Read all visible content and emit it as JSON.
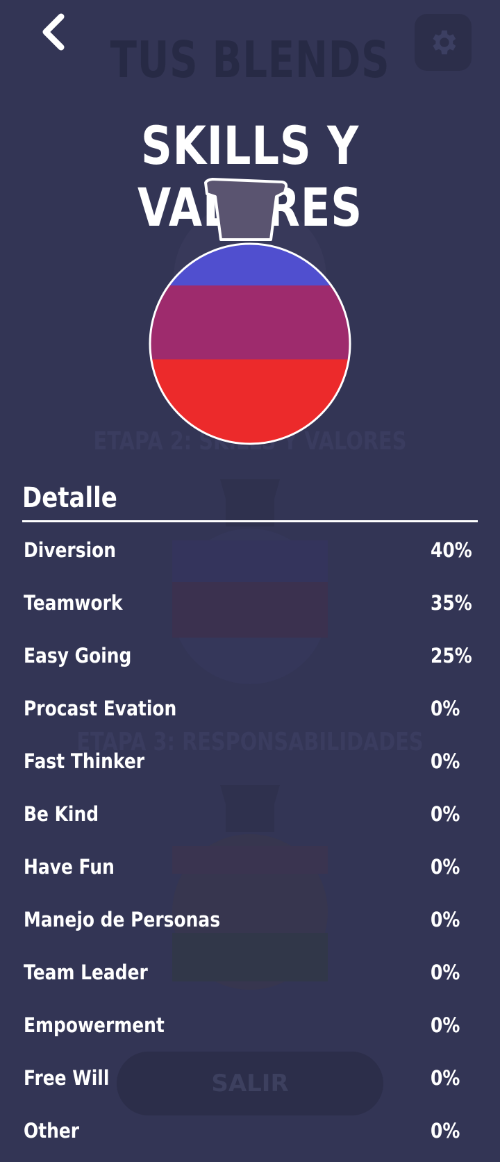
{
  "background": {
    "title": "TUS BLENDS",
    "stage_2": "ETAPA 2: SKILLS Y VALORES",
    "stage_3": "ETAPA 3: RESPONSABILIDADES",
    "exit_label": "SALIR"
  },
  "header": {
    "title": "SKILLS Y VALORES",
    "back_icon": "chevron-left-icon",
    "settings_icon": "gear-icon"
  },
  "blend": {
    "layers": [
      {
        "color": "#504fcf",
        "share": 0.25
      },
      {
        "color": "#9e2b6d",
        "share": 0.35
      },
      {
        "color": "#ec2a2b",
        "share": 0.4
      }
    ]
  },
  "detail": {
    "heading": "Detalle",
    "items": [
      {
        "name": "Diversion",
        "percent": "40%"
      },
      {
        "name": "Teamwork",
        "percent": "35%"
      },
      {
        "name": "Easy Going",
        "percent": "25%"
      },
      {
        "name": "Procast Evation",
        "percent": "0%"
      },
      {
        "name": "Fast Thinker",
        "percent": "0%"
      },
      {
        "name": "Be Kind",
        "percent": "0%"
      },
      {
        "name": "Have Fun",
        "percent": "0%"
      },
      {
        "name": "Manejo de Personas",
        "percent": "0%"
      },
      {
        "name": "Team Leader",
        "percent": "0%"
      },
      {
        "name": "Empowerment",
        "percent": "0%"
      },
      {
        "name": "Free Will",
        "percent": "0%"
      },
      {
        "name": "Other",
        "percent": "0%"
      }
    ]
  }
}
